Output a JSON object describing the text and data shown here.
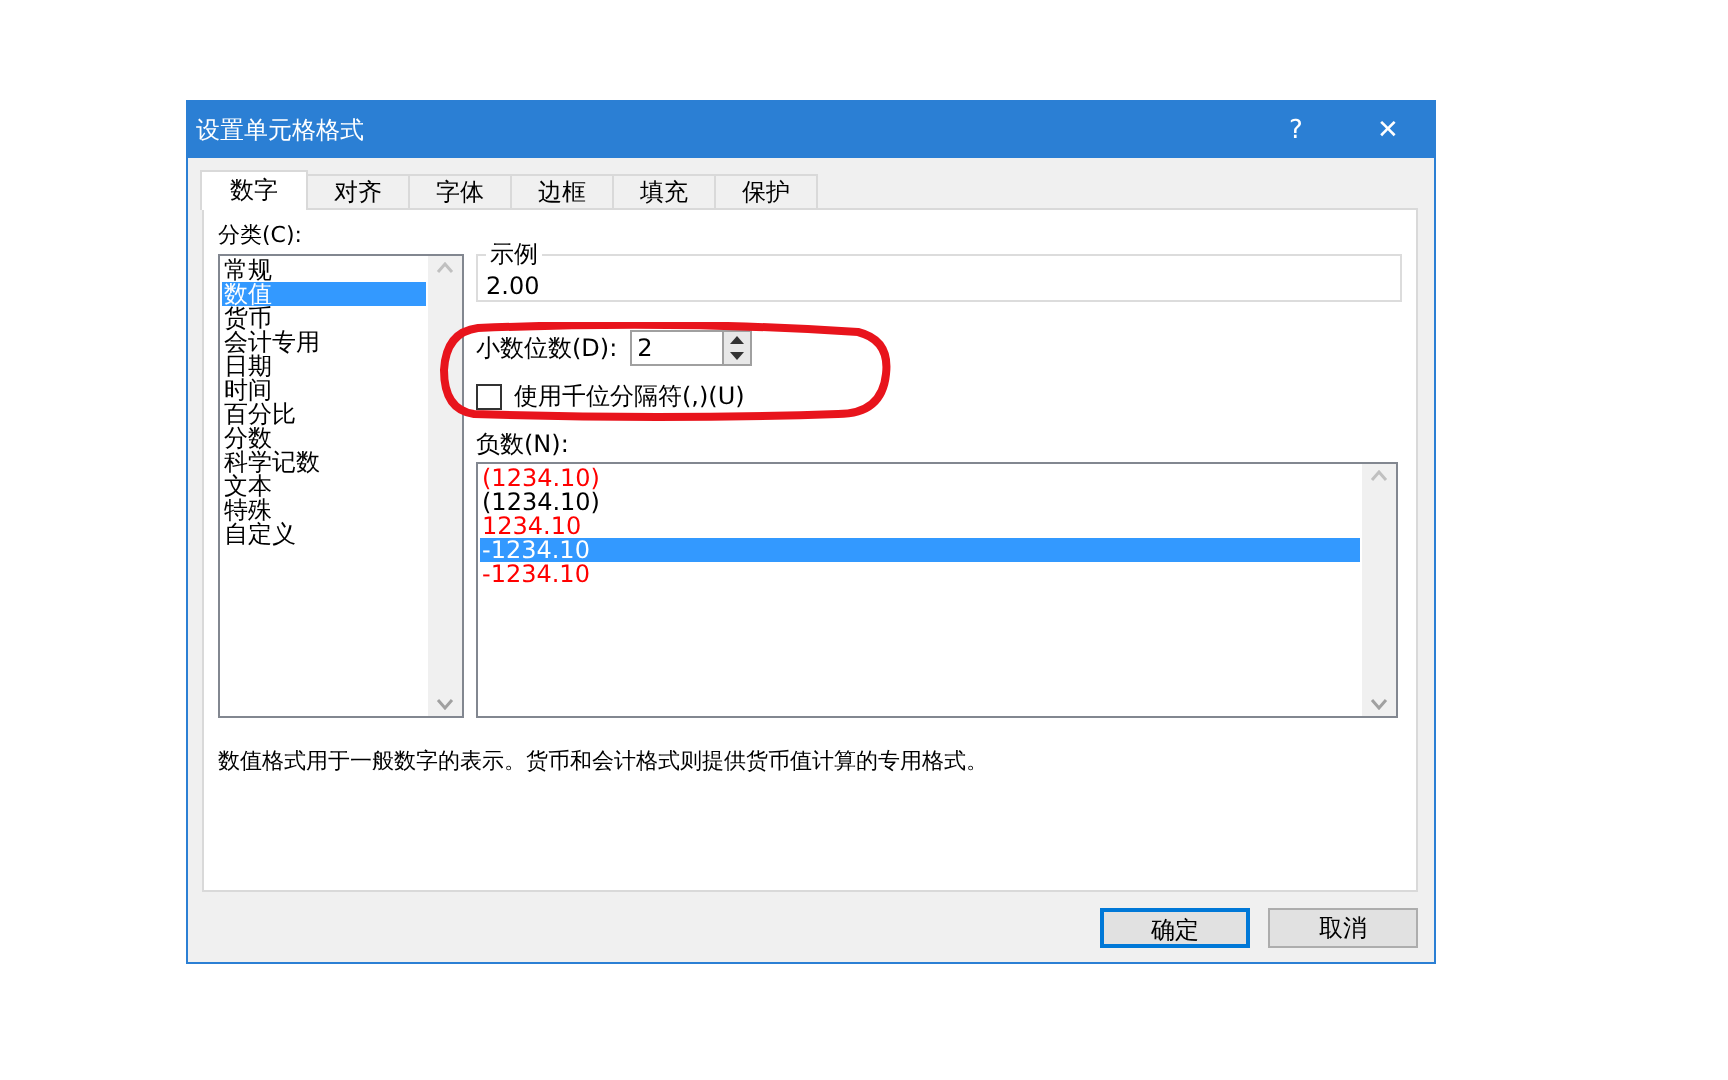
{
  "window": {
    "title": "设置单元格格式",
    "help": "?",
    "close": "✕"
  },
  "tabs": [
    {
      "label": "数字",
      "selected": true
    },
    {
      "label": "对齐",
      "selected": false
    },
    {
      "label": "字体",
      "selected": false
    },
    {
      "label": "边框",
      "selected": false
    },
    {
      "label": "填充",
      "selected": false
    },
    {
      "label": "保护",
      "selected": false
    }
  ],
  "category": {
    "label": "分类(C):",
    "items": [
      {
        "label": "常规",
        "selected": false
      },
      {
        "label": "数值",
        "selected": true
      },
      {
        "label": "货币",
        "selected": false
      },
      {
        "label": "会计专用",
        "selected": false
      },
      {
        "label": "日期",
        "selected": false
      },
      {
        "label": "时间",
        "selected": false
      },
      {
        "label": "百分比",
        "selected": false
      },
      {
        "label": "分数",
        "selected": false
      },
      {
        "label": "科学记数",
        "selected": false
      },
      {
        "label": "文本",
        "selected": false
      },
      {
        "label": "特殊",
        "selected": false
      },
      {
        "label": "自定义",
        "selected": false
      }
    ]
  },
  "sample": {
    "label": "示例",
    "value": "2.00"
  },
  "decimal_places": {
    "label": "小数位数(D):",
    "value": "2"
  },
  "thousands_separator": {
    "label": "使用千位分隔符(,)(U)",
    "checked": false
  },
  "negative_numbers": {
    "label": "负数(N):",
    "items": [
      {
        "label": "(1234.10)",
        "color": "#ff0000",
        "selected": false
      },
      {
        "label": "(1234.10)",
        "color": "#000000",
        "selected": false
      },
      {
        "label": "1234.10",
        "color": "#ff0000",
        "selected": false
      },
      {
        "label": "-1234.10",
        "selected": true
      },
      {
        "label": "-1234.10",
        "color": "#ff0000",
        "selected": false
      }
    ]
  },
  "description": "数值格式用于一般数字的表示。货币和会计格式则提供货币值计算的专用格式。",
  "buttons": [
    {
      "label": "确定",
      "default": true
    },
    {
      "label": "取消",
      "default": false
    }
  ]
}
